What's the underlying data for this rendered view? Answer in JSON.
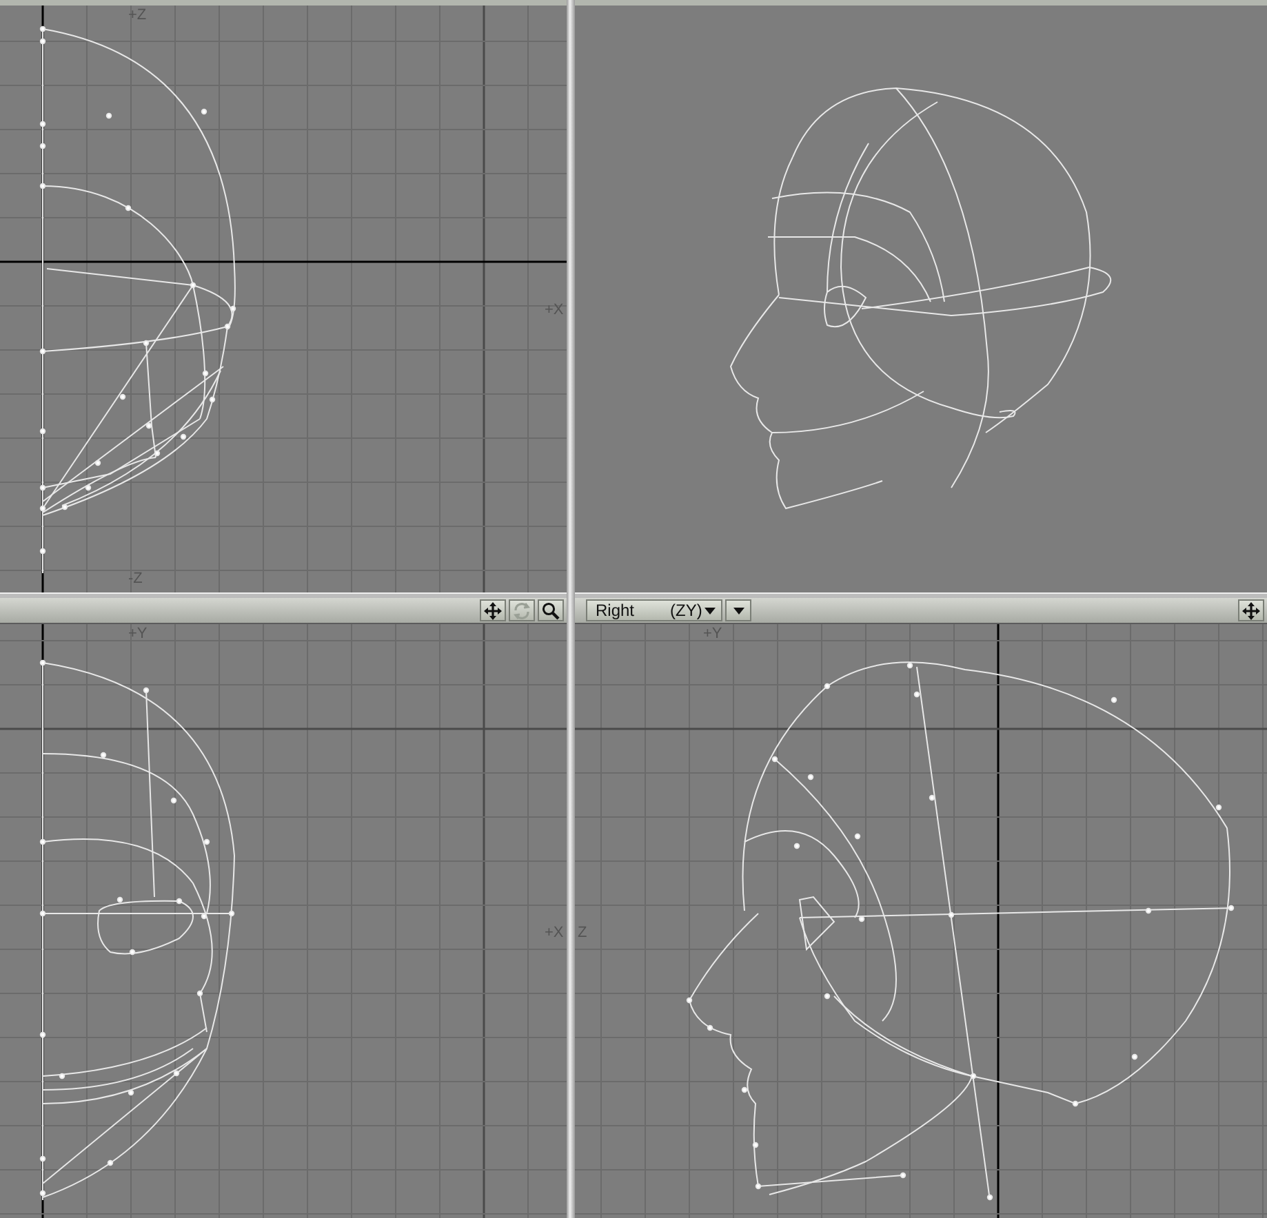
{
  "viewports": [
    {
      "kind": "top",
      "axis_labels": {
        "top": "+Z",
        "bottom": "-Z",
        "right": "+X"
      }
    },
    {
      "kind": "perspective"
    },
    {
      "kind": "front",
      "toolbar": [
        {
          "kind": "move",
          "disabled": false
        },
        {
          "kind": "rotate",
          "disabled": true
        },
        {
          "kind": "zoom",
          "disabled": false
        }
      ],
      "axis_labels": {
        "top": "+Y",
        "right": "+X"
      }
    },
    {
      "kind": "right",
      "view_menu": {
        "label": "Right",
        "projection": "(ZY)"
      },
      "toolbar": [
        {
          "kind": "move",
          "disabled": false
        }
      ],
      "axis_labels": {
        "top": "+Y",
        "left": "Z"
      }
    }
  ]
}
